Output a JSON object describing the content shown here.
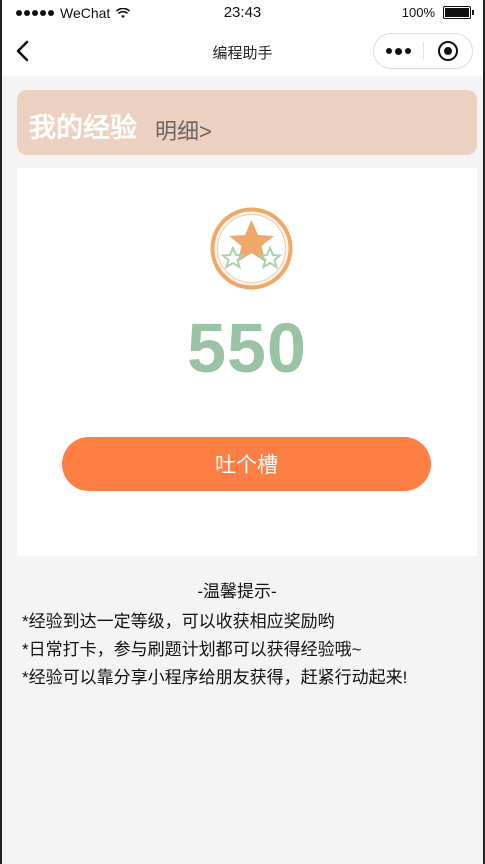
{
  "status_bar": {
    "carrier": "WeChat",
    "time": "23:43",
    "battery_percent": "100%",
    "battery_level": 1.0
  },
  "nav": {
    "title": "编程助手",
    "back_icon": "chevron-left-icon",
    "more_icon": "more-dots-icon",
    "home_icon": "target-icon"
  },
  "header": {
    "title": "我的经验",
    "detail_link": "明细>"
  },
  "card": {
    "badge_icon": "star-badge-icon",
    "experience_value": "550",
    "button_label": "吐个槽"
  },
  "tips": {
    "title": "-温馨提示-",
    "items": [
      "*经验到达一定等级，可以收获相应奖励哟",
      "*日常打卡，参与刷题计划都可以获得经验哦~",
      "*经验可以靠分享小程序给朋友获得，赶紧行动起来!"
    ]
  },
  "colors": {
    "header_bg": "#ecd1c2",
    "value_color": "#9ac2a4",
    "button_color": "#fe7e43",
    "badge_color": "#f0a868"
  }
}
